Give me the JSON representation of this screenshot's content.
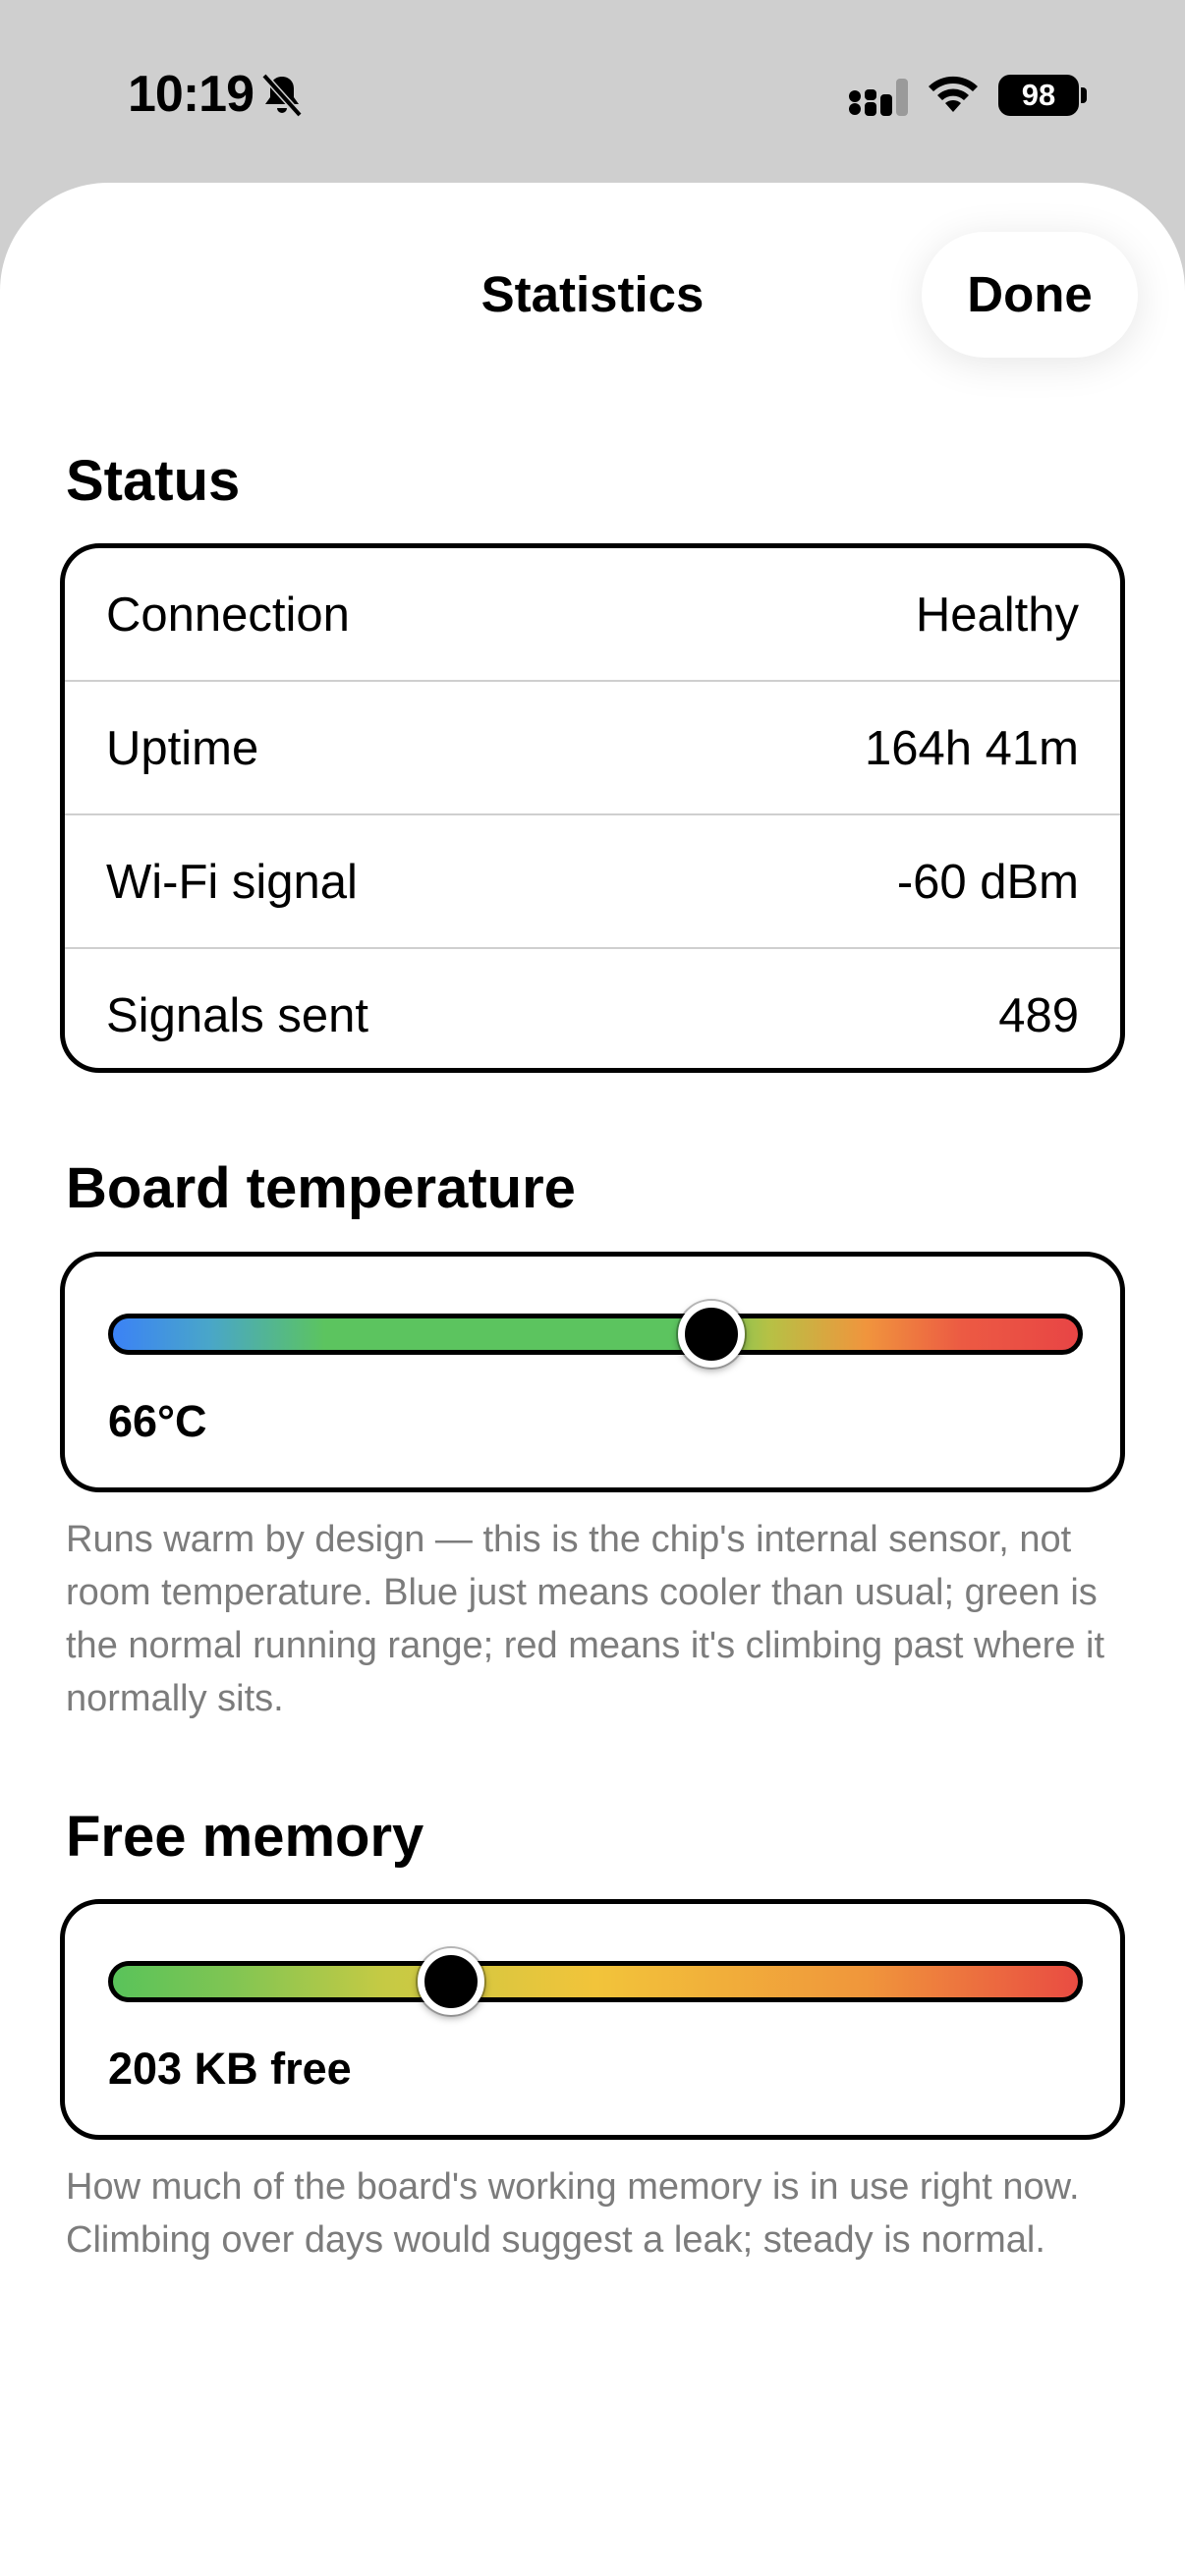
{
  "status_bar": {
    "time": "10:19",
    "battery": "98",
    "icons": [
      "bell-slash-icon",
      "cellular-signal-icon",
      "wifi-icon",
      "battery-icon"
    ]
  },
  "sheet": {
    "title": "Statistics",
    "done_label": "Done"
  },
  "status": {
    "title": "Status",
    "rows": [
      {
        "label": "Connection",
        "value": "Healthy"
      },
      {
        "label": "Uptime",
        "value": "164h 41m"
      },
      {
        "label": "Wi-Fi signal",
        "value": "-60 dBm"
      },
      {
        "label": "Signals sent",
        "value": "489"
      }
    ]
  },
  "temperature": {
    "title": "Board temperature",
    "reading": "66°C",
    "level": 0.62,
    "note": "Runs warm by design — this is the chip's internal sensor, not room temperature. Blue just means cooler than usual; green is the normal running range; red means it's climbing past where it normally sits."
  },
  "memory": {
    "title": "Free memory",
    "reading": "203 KB free",
    "level": 0.35,
    "note": "How much of the board's working memory is in use right now. Climbing over days would suggest a leak; steady is normal."
  },
  "colors": {
    "background": "#cfcfcf",
    "sheet": "#ffffff",
    "footnote": "#7c7c7c"
  }
}
